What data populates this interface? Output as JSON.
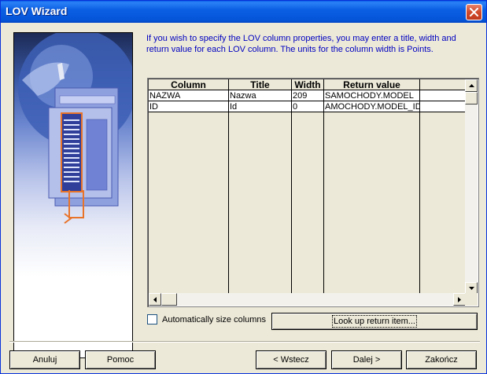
{
  "window": {
    "title": "LOV Wizard"
  },
  "instructions": "If you wish to specify the LOV column properties, you may enter a title, width and return value for each LOV column. The units for the column width is Points.",
  "grid": {
    "columns": [
      "Column",
      "Title",
      "Width",
      "Return value"
    ],
    "rows": [
      [
        "NAZWA",
        "Nazwa",
        "209",
        "SAMOCHODY.MODEL"
      ],
      [
        "ID",
        "Id",
        "0",
        "AMOCHODY.MODEL_ID"
      ]
    ]
  },
  "options": {
    "auto_size_label": "Automatically size columns",
    "auto_size_checked": false
  },
  "lookup_button": "Look up return item...",
  "footer": {
    "cancel": "Anuluj",
    "help": "Pomoc",
    "back": "< Wstecz",
    "next": "Dalej >",
    "finish": "Zakończ"
  },
  "colors": {
    "titlebar": "#0554d8",
    "instructions_text": "#0000c0",
    "dialog_bg": "#ece9d8"
  }
}
